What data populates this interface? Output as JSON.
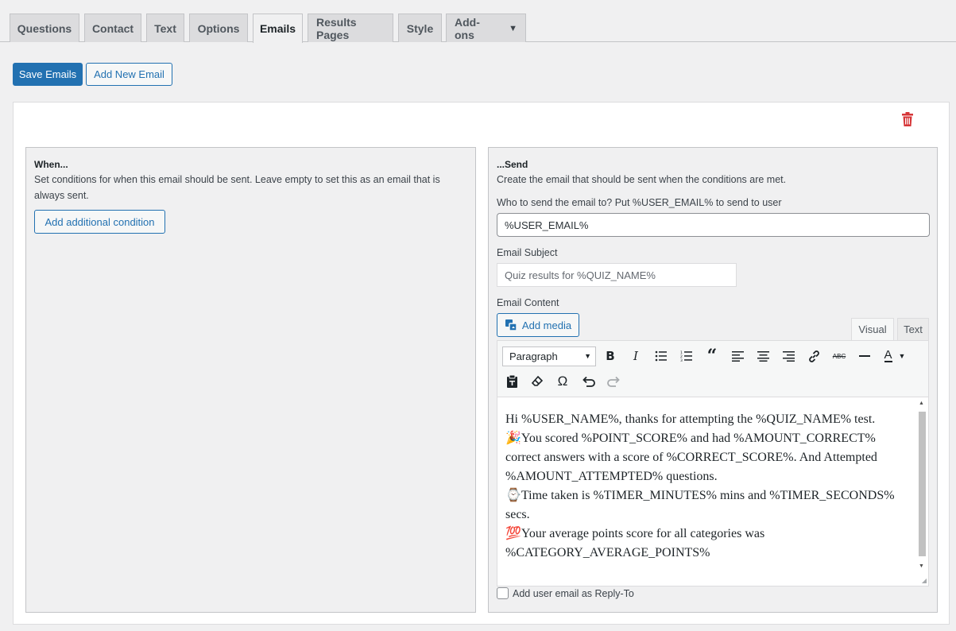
{
  "tabs": [
    {
      "label": "Questions"
    },
    {
      "label": "Contact"
    },
    {
      "label": "Text"
    },
    {
      "label": "Options"
    },
    {
      "label": "Emails",
      "active": true
    },
    {
      "label": "Results Pages"
    },
    {
      "label": "Style"
    },
    {
      "label": "Add-ons",
      "dropdown": true
    }
  ],
  "actions": {
    "save_label": "Save Emails",
    "add_email_label": "Add New Email"
  },
  "email": {
    "delete_icon": "trash-icon",
    "when": {
      "title": "When...",
      "description": "Set conditions for when this email should be sent. Leave empty to set this as an email that is always sent.",
      "add_condition_label": "Add additional condition"
    },
    "send": {
      "title": "...Send",
      "description": "Create the email that should be sent when the conditions are met.",
      "to_label": "Who to send the email to? Put %USER_EMAIL% to send to user",
      "to_value": "%USER_EMAIL%",
      "subject_label": "Email Subject",
      "subject_value": "Quiz results for %QUIZ_NAME%",
      "content_label": "Email Content",
      "add_media_label": "Add media",
      "editor_tabs": {
        "visual": "Visual",
        "text": "Text"
      },
      "format_select": "Paragraph",
      "content_lines": [
        "Hi %USER_NAME%, thanks for attempting the %QUIZ_NAME% test.",
        "🎉You scored %POINT_SCORE% and had %AMOUNT_CORRECT% correct answers with a score of %CORRECT_SCORE%. And Attempted %AMOUNT_ATTEMPTED% questions.",
        "⌚Time taken is %TIMER_MINUTES% mins and %TIMER_SECONDS% secs.",
        "💯Your average points score for all categories was %CATEGORY_AVERAGE_POINTS%"
      ],
      "reply_to_label": "Add user email as Reply-To",
      "reply_to_checked": false
    }
  },
  "colors": {
    "primary": "#2271b1",
    "delete": "#d63638",
    "background": "#f0f0f1"
  }
}
